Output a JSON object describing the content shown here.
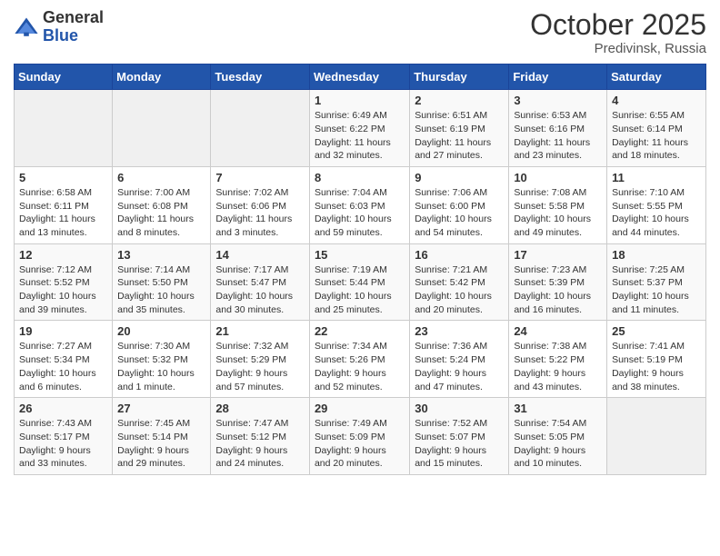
{
  "header": {
    "logo_general": "General",
    "logo_blue": "Blue",
    "month": "October 2025",
    "location": "Predivinsk, Russia"
  },
  "weekdays": [
    "Sunday",
    "Monday",
    "Tuesday",
    "Wednesday",
    "Thursday",
    "Friday",
    "Saturday"
  ],
  "weeks": [
    [
      {
        "day": "",
        "info": ""
      },
      {
        "day": "",
        "info": ""
      },
      {
        "day": "",
        "info": ""
      },
      {
        "day": "1",
        "info": "Sunrise: 6:49 AM\nSunset: 6:22 PM\nDaylight: 11 hours\nand 32 minutes."
      },
      {
        "day": "2",
        "info": "Sunrise: 6:51 AM\nSunset: 6:19 PM\nDaylight: 11 hours\nand 27 minutes."
      },
      {
        "day": "3",
        "info": "Sunrise: 6:53 AM\nSunset: 6:16 PM\nDaylight: 11 hours\nand 23 minutes."
      },
      {
        "day": "4",
        "info": "Sunrise: 6:55 AM\nSunset: 6:14 PM\nDaylight: 11 hours\nand 18 minutes."
      }
    ],
    [
      {
        "day": "5",
        "info": "Sunrise: 6:58 AM\nSunset: 6:11 PM\nDaylight: 11 hours\nand 13 minutes."
      },
      {
        "day": "6",
        "info": "Sunrise: 7:00 AM\nSunset: 6:08 PM\nDaylight: 11 hours\nand 8 minutes."
      },
      {
        "day": "7",
        "info": "Sunrise: 7:02 AM\nSunset: 6:06 PM\nDaylight: 11 hours\nand 3 minutes."
      },
      {
        "day": "8",
        "info": "Sunrise: 7:04 AM\nSunset: 6:03 PM\nDaylight: 10 hours\nand 59 minutes."
      },
      {
        "day": "9",
        "info": "Sunrise: 7:06 AM\nSunset: 6:00 PM\nDaylight: 10 hours\nand 54 minutes."
      },
      {
        "day": "10",
        "info": "Sunrise: 7:08 AM\nSunset: 5:58 PM\nDaylight: 10 hours\nand 49 minutes."
      },
      {
        "day": "11",
        "info": "Sunrise: 7:10 AM\nSunset: 5:55 PM\nDaylight: 10 hours\nand 44 minutes."
      }
    ],
    [
      {
        "day": "12",
        "info": "Sunrise: 7:12 AM\nSunset: 5:52 PM\nDaylight: 10 hours\nand 39 minutes."
      },
      {
        "day": "13",
        "info": "Sunrise: 7:14 AM\nSunset: 5:50 PM\nDaylight: 10 hours\nand 35 minutes."
      },
      {
        "day": "14",
        "info": "Sunrise: 7:17 AM\nSunset: 5:47 PM\nDaylight: 10 hours\nand 30 minutes."
      },
      {
        "day": "15",
        "info": "Sunrise: 7:19 AM\nSunset: 5:44 PM\nDaylight: 10 hours\nand 25 minutes."
      },
      {
        "day": "16",
        "info": "Sunrise: 7:21 AM\nSunset: 5:42 PM\nDaylight: 10 hours\nand 20 minutes."
      },
      {
        "day": "17",
        "info": "Sunrise: 7:23 AM\nSunset: 5:39 PM\nDaylight: 10 hours\nand 16 minutes."
      },
      {
        "day": "18",
        "info": "Sunrise: 7:25 AM\nSunset: 5:37 PM\nDaylight: 10 hours\nand 11 minutes."
      }
    ],
    [
      {
        "day": "19",
        "info": "Sunrise: 7:27 AM\nSunset: 5:34 PM\nDaylight: 10 hours\nand 6 minutes."
      },
      {
        "day": "20",
        "info": "Sunrise: 7:30 AM\nSunset: 5:32 PM\nDaylight: 10 hours\nand 1 minute."
      },
      {
        "day": "21",
        "info": "Sunrise: 7:32 AM\nSunset: 5:29 PM\nDaylight: 9 hours\nand 57 minutes."
      },
      {
        "day": "22",
        "info": "Sunrise: 7:34 AM\nSunset: 5:26 PM\nDaylight: 9 hours\nand 52 minutes."
      },
      {
        "day": "23",
        "info": "Sunrise: 7:36 AM\nSunset: 5:24 PM\nDaylight: 9 hours\nand 47 minutes."
      },
      {
        "day": "24",
        "info": "Sunrise: 7:38 AM\nSunset: 5:22 PM\nDaylight: 9 hours\nand 43 minutes."
      },
      {
        "day": "25",
        "info": "Sunrise: 7:41 AM\nSunset: 5:19 PM\nDaylight: 9 hours\nand 38 minutes."
      }
    ],
    [
      {
        "day": "26",
        "info": "Sunrise: 7:43 AM\nSunset: 5:17 PM\nDaylight: 9 hours\nand 33 minutes."
      },
      {
        "day": "27",
        "info": "Sunrise: 7:45 AM\nSunset: 5:14 PM\nDaylight: 9 hours\nand 29 minutes."
      },
      {
        "day": "28",
        "info": "Sunrise: 7:47 AM\nSunset: 5:12 PM\nDaylight: 9 hours\nand 24 minutes."
      },
      {
        "day": "29",
        "info": "Sunrise: 7:49 AM\nSunset: 5:09 PM\nDaylight: 9 hours\nand 20 minutes."
      },
      {
        "day": "30",
        "info": "Sunrise: 7:52 AM\nSunset: 5:07 PM\nDaylight: 9 hours\nand 15 minutes."
      },
      {
        "day": "31",
        "info": "Sunrise: 7:54 AM\nSunset: 5:05 PM\nDaylight: 9 hours\nand 10 minutes."
      },
      {
        "day": "",
        "info": ""
      }
    ]
  ]
}
